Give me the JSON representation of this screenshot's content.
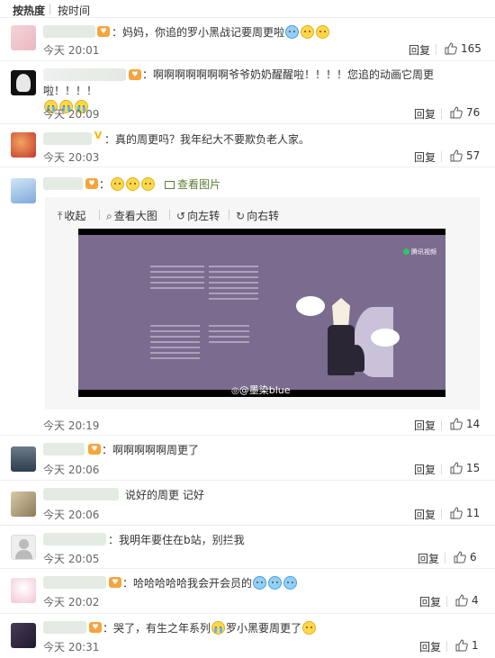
{
  "sort_tabs": [
    "按热度",
    "按时间"
  ],
  "common": {
    "reply_label": "回复"
  },
  "comments": [
    {
      "text": "：妈妈，你追的罗小黑战记要周更啦",
      "time": "今天 20:01",
      "likes": "165"
    },
    {
      "text": "：啊啊啊啊啊啊啊爷爷奶奶醒醒啦！！！！您追的动画它周更啦！！！！",
      "time": "今天 20:09",
      "likes": "76"
    },
    {
      "text": "：真的周更吗？我年纪大不要欺负老人家。",
      "time": "今天 20:03",
      "likes": "57"
    },
    {
      "text": "：",
      "time": "今天 20:19",
      "likes": "14",
      "view_pic": "查看图片",
      "image_tools": [
        "收起",
        "查看大图",
        "向左转",
        "向右转"
      ],
      "watermark": "@墨染blue",
      "logo": "腾讯视频"
    },
    {
      "text": "：啊啊啊啊啊周更了",
      "time": "今天 20:06",
      "likes": "15"
    },
    {
      "text": "说好的周更 记好",
      "time": "今天 20:06",
      "likes": "11"
    },
    {
      "text": "：我明年要住在b站，别拦我",
      "time": "今天 20:05",
      "likes": "6"
    },
    {
      "text": "：哈哈哈哈哈我会开会员的",
      "time": "今天 20:02",
      "likes": "4"
    },
    {
      "text": "：哭了，有生之年系列",
      "text2": "罗小黑要周更了",
      "time": "今天 20:31",
      "likes": "1"
    }
  ],
  "colors": {
    "link_green": "#5d7c33",
    "separator": "#eeeeee",
    "image_bg": "#7b6b8f"
  },
  "icons": {
    "like": "thumbs-up-icon",
    "pic": "picture-icon",
    "medal": "fan-medal-icon"
  }
}
